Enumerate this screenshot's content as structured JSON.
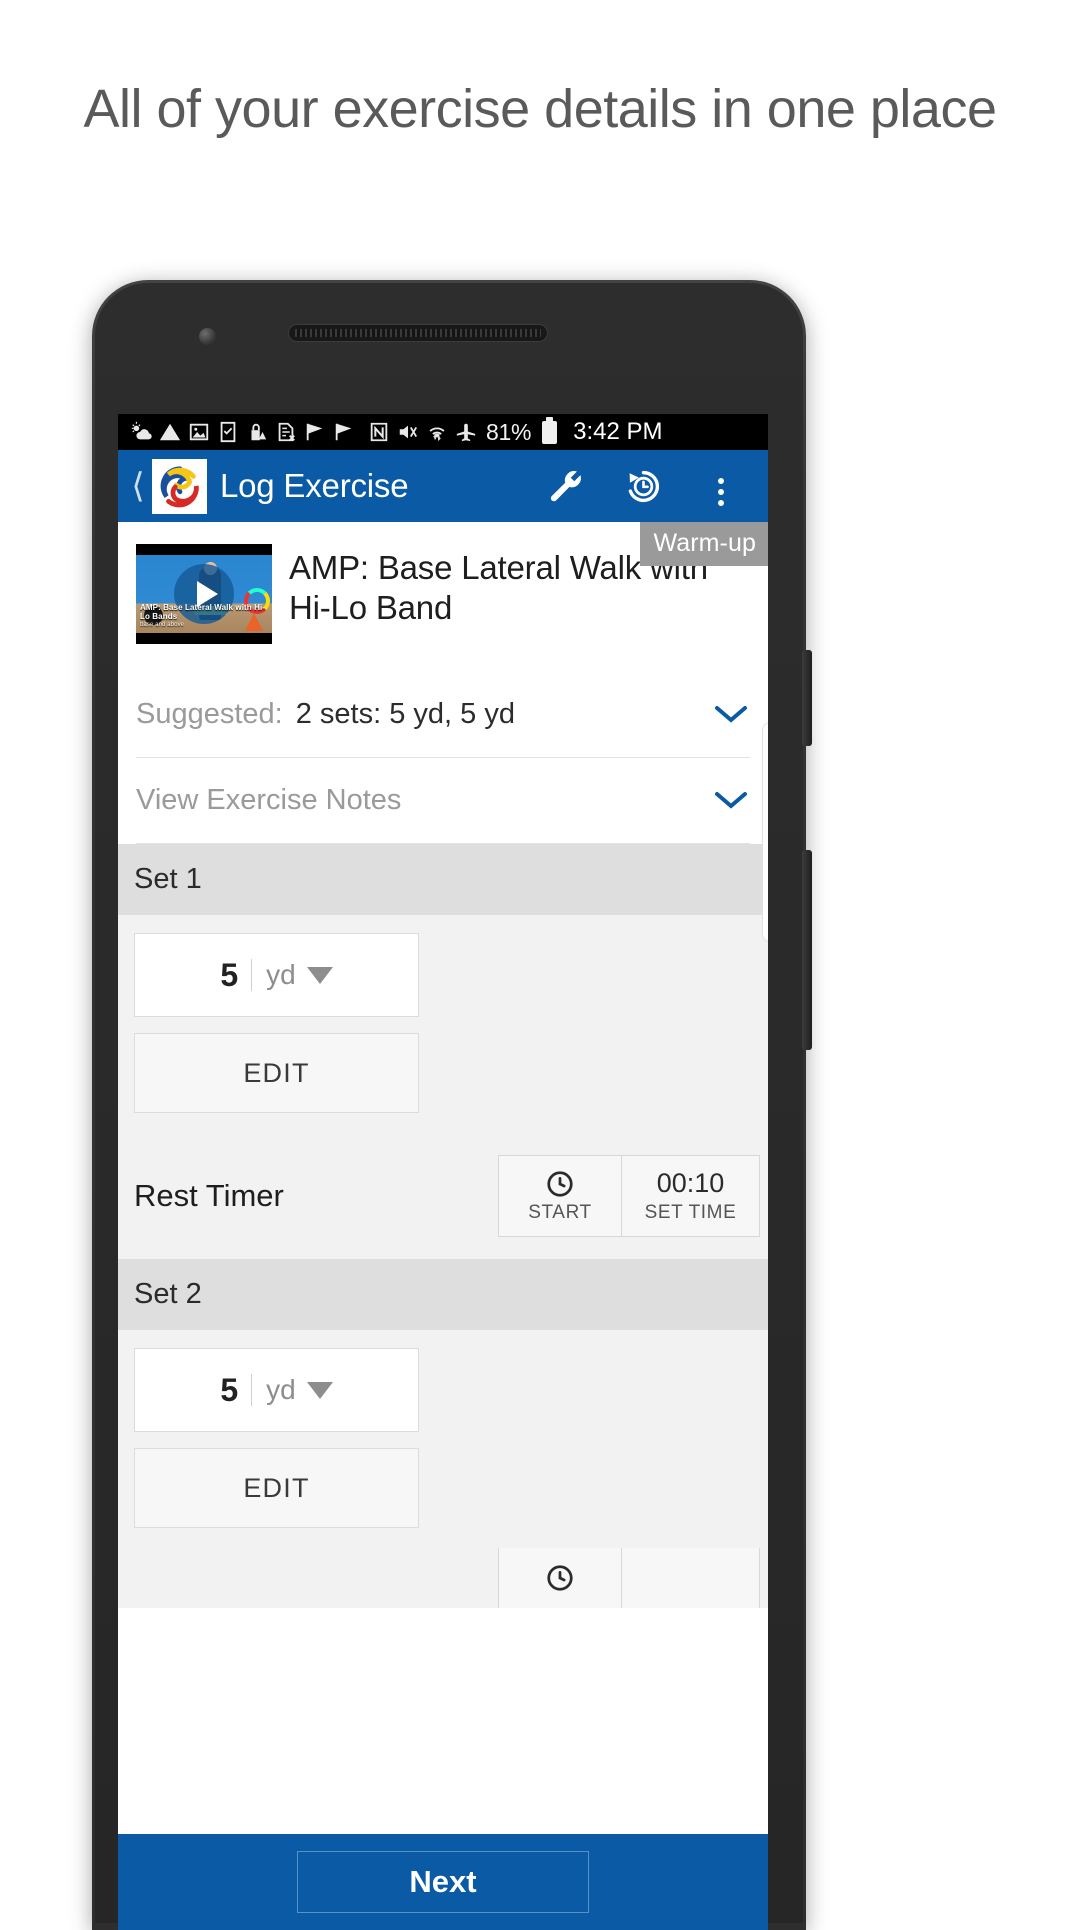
{
  "promo": {
    "headline": "All of your exercise details in one place"
  },
  "statusbar": {
    "icons": [
      "weather-partly-cloudy-icon",
      "warning-triangle-icon",
      "image-icon",
      "checkbox-note-icon",
      "lock-alert-icon",
      "sim-card-error-icon",
      "flag-icon",
      "flag-icon",
      "nfc-icon",
      "volume-mute-vibrate-icon",
      "wifi-transfer-icon",
      "airplane-mode-icon"
    ],
    "battery_percent": "81%",
    "battery_icon": "battery-full-icon",
    "time": "3:42 PM"
  },
  "appbar": {
    "back_icon": "chevron-left-icon",
    "logo_icon": "app-logo-icon",
    "title": "Log Exercise",
    "actions": [
      {
        "icon": "wrench-icon",
        "name": "settings-wrench-button"
      },
      {
        "icon": "history-clock-icon",
        "name": "history-button"
      },
      {
        "icon": "overflow-menu-icon",
        "name": "overflow-menu-button"
      }
    ]
  },
  "exercise": {
    "badge": "Warm-up",
    "thumbnail_caption": "AMP: Base Lateral Walk with Hi-Lo Bands",
    "thumbnail_subcaption": "base and above",
    "play_icon": "play-icon",
    "title": "AMP: Base Lateral Walk with Hi-Lo Band"
  },
  "suggested": {
    "label": "Suggested:",
    "value": "2 sets: 5 yd, 5 yd",
    "chevron_icon": "chevron-down-icon"
  },
  "notes": {
    "label": "View Exercise Notes",
    "chevron_icon": "chevron-down-icon"
  },
  "sets": [
    {
      "header": "Set 1",
      "value": "5",
      "unit": "yd",
      "unit_caret_icon": "caret-down-icon",
      "edit_label": "EDIT"
    },
    {
      "header": "Set 2",
      "value": "5",
      "unit": "yd",
      "unit_caret_icon": "caret-down-icon",
      "edit_label": "EDIT"
    }
  ],
  "rest_timer": {
    "label": "Rest Timer",
    "start_icon": "clock-icon",
    "start_label": "START",
    "time_value": "00:10",
    "time_label": "SET TIME"
  },
  "bottom": {
    "next_label": "Next"
  },
  "colors": {
    "brand_blue": "#0b5aa5",
    "badge_gray": "#9a9a9a",
    "set_header_gray": "#dedede",
    "headline_gray": "#5a5a5a"
  }
}
